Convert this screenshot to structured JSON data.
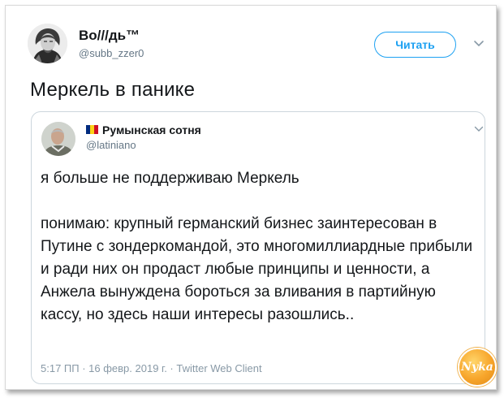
{
  "tweet": {
    "author": {
      "name": "Bo///дь™",
      "handle": "@subb_zzer0",
      "avatar_icon": "engraved-portrait-avatar"
    },
    "follow_label": "Читать",
    "menu_icon": "chevron-down-icon",
    "text": "Меркель в панике"
  },
  "quoted_tweet": {
    "author": {
      "flag_colors": [
        "#002b7f",
        "#fcd116",
        "#ce1126"
      ],
      "name": "Румынская сотня",
      "handle": "@latiniano",
      "avatar_icon": "man-photo-avatar"
    },
    "paragraph1": "я больше не поддерживаю Меркель",
    "paragraph2": "понимаю: крупный германский бизнес заинтересован в Путине с зондеркомандой, это многомиллиардные прибыли и ради них он продаст любые принципы и ценности, а Анжела вынуждена бороться за вливания в партийную кассу, но здесь наши интересы разошлись..",
    "meta": "5:17 ПП · 16 февр. 2019 г. · Twitter Web Client"
  },
  "watermark": {
    "text": "Nyka"
  },
  "colors": {
    "accent": "#1da1f2",
    "text": "#14171a",
    "secondary": "#657786",
    "border": "#ccd6dd"
  }
}
